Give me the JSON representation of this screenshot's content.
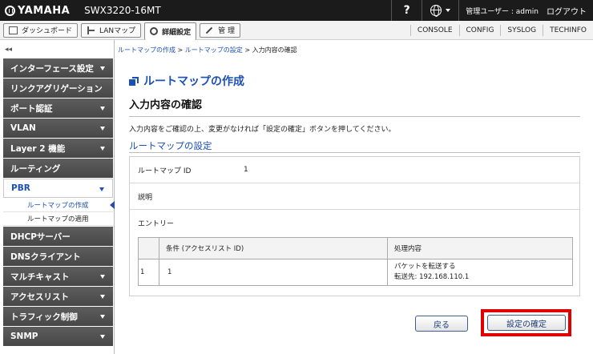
{
  "app": {
    "brand": "YAMAHA",
    "model": "SWX3220-16MT",
    "help_label": "?",
    "user_label": "管理ユーザー : admin",
    "logout_label": "ログアウト"
  },
  "nav": {
    "dashboard_label": "ダッシュボード",
    "lanmap_label": "LANマップ",
    "detail_label": "詳細設定",
    "admin_label": "管 理",
    "links": [
      "CONSOLE",
      "CONFIG",
      "SYSLOG",
      "TECHINFO"
    ]
  },
  "sidebar": {
    "collapse": "◂◂",
    "items": [
      {
        "label": "インターフェース設定"
      },
      {
        "label": "リンクアグリゲーション"
      },
      {
        "label": "ポート認証"
      },
      {
        "label": "VLAN"
      },
      {
        "label": "Layer 2 機能"
      },
      {
        "label": "ルーティング"
      },
      {
        "label": "PBR"
      },
      {
        "label": "DHCPサーバー"
      },
      {
        "label": "DNSクライアント"
      },
      {
        "label": "マルチキャスト"
      },
      {
        "label": "アクセスリスト"
      },
      {
        "label": "トラフィック制御"
      },
      {
        "label": "SNMP"
      }
    ],
    "pbr_sub": [
      "ルートマップの作成",
      "ルートマップの適用"
    ]
  },
  "main": {
    "breadcrumb": {
      "crumb1": "ルートマップの作成",
      "crumb2": "ルートマップの設定",
      "sep": " > ",
      "current": "入力内容の確認"
    },
    "page_title": "ルートマップの作成",
    "section_title": "入力内容の確認",
    "instruction": "入力内容をご確認の上、変更がなければ「設定の確定」ボタンを押してください。",
    "sub_title": "ルートマップの設定",
    "fields": {
      "id_label": "ルートマップ ID",
      "id_value": "1",
      "desc_label": "説明",
      "entry_label": "エントリー"
    },
    "entry_table": {
      "headers": [
        "",
        "条件 (アクセスリスト ID)",
        "処理内容"
      ],
      "row": {
        "index": "1",
        "condition": "1",
        "action_line1": "パケットを転送する",
        "action_line2": "転送先: 192.168.110.1"
      }
    },
    "buttons": {
      "back": "戻る",
      "confirm": "設定の確定"
    },
    "highlight_color": "#e00000",
    "accent_color": "#1a50b5"
  }
}
